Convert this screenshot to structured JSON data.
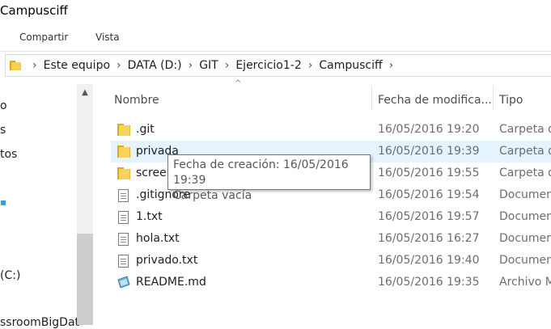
{
  "window": {
    "title": "Campusciff"
  },
  "ribbon": {
    "tabs": [
      "Compartir",
      "Vista"
    ]
  },
  "address_bar": {
    "crumbs": [
      "Este equipo",
      "DATA (D:)",
      "GIT",
      "Ejercicio1-2",
      "Campusciff"
    ]
  },
  "nav_pane": {
    "items": [
      "o",
      "s",
      "tos",
      "(C:)",
      "ssroomBigDat"
    ]
  },
  "columns": {
    "name": "Nombre",
    "date": "Fecha de modifica...",
    "type": "Tipo"
  },
  "files": [
    {
      "name": ".git",
      "date": "16/05/2016 19:20",
      "type": "Carpeta d",
      "icon": "folder-icon"
    },
    {
      "name": "privada",
      "date": "16/05/2016 19:39",
      "type": "Carpeta d",
      "icon": "folder-icon"
    },
    {
      "name": "screen",
      "date": "16/05/2016 19:55",
      "type": "Carpeta d",
      "icon": "folder-icon"
    },
    {
      "name": ".gitignore",
      "date": "16/05/2016 19:54",
      "type": "Documen",
      "icon": "text-file-icon"
    },
    {
      "name": "1.txt",
      "date": "16/05/2016 19:57",
      "type": "Documen",
      "icon": "text-file-icon"
    },
    {
      "name": "hola.txt",
      "date": "16/05/2016 16:27",
      "type": "Documen",
      "icon": "text-file-icon"
    },
    {
      "name": "privado.txt",
      "date": "16/05/2016 19:40",
      "type": "Documen",
      "icon": "text-file-icon"
    },
    {
      "name": "README.md",
      "date": "16/05/2016 19:35",
      "type": "Archivo M",
      "icon": "markdown-file-icon"
    }
  ],
  "tooltip": {
    "line1": "Fecha de creación: 16/05/2016 19:39",
    "line2": "Carpeta vacía"
  },
  "colors": {
    "hover_row": "#e5f3ff",
    "folder": "#f8d35c",
    "accent": "#2aa6d6"
  }
}
